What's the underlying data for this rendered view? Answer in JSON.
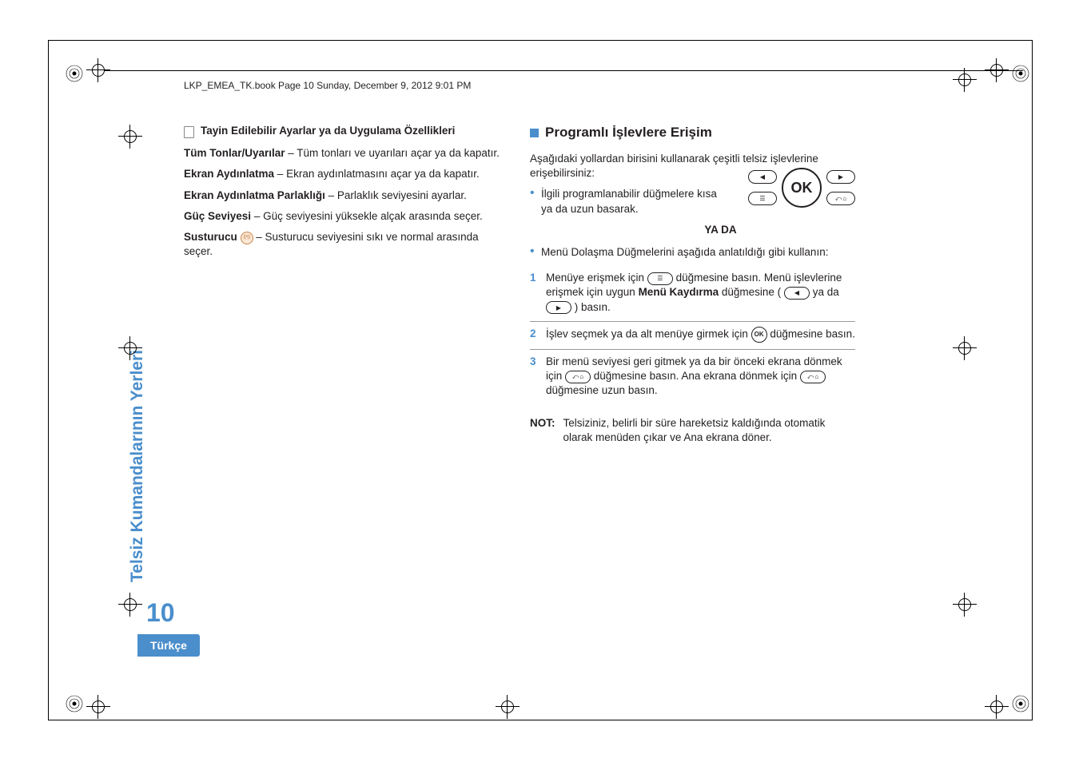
{
  "header": {
    "running_head": "LKP_EMEA_TK.book  Page 10  Sunday, December 9, 2012  9:01 PM"
  },
  "sidebar": {
    "section_title": "Telsiz Kumandalarının Yerleri",
    "page_number": "10",
    "language": "Türkçe"
  },
  "left": {
    "subheading": "Tayin Edilebilir Ayarlar ya da Uygulama Özellikleri",
    "defs": [
      {
        "term": "Tüm Tonlar/Uyarılar",
        "sep": " – ",
        "text": "Tüm tonları ve uyarıları açar ya da kapatır."
      },
      {
        "term": "Ekran Aydınlatma",
        "sep": " – ",
        "text": "Ekran aydınlatmasını açar ya da kapatır."
      },
      {
        "term": "Ekran Aydınlatma Parlaklığı",
        "sep": " – ",
        "text": "Parlaklık seviyesini ayarlar."
      },
      {
        "term": "Güç Seviyesi",
        "sep": " – ",
        "text": "Güç seviyesini yüksekle alçak arasında seçer."
      },
      {
        "term": "Susturucu",
        "sep": "  – ",
        "text": "Susturucu seviyesini sıkı ve normal arasında seçer."
      }
    ]
  },
  "right": {
    "heading": "Programlı İşlevlere Erişim",
    "intro": "Aşağıdaki yollardan birisini kullanarak çeşitli telsiz işlevlerine erişebilirsiniz:",
    "bullet1": "İlgili programlanabilir düğmelere kısa ya da uzun basarak.",
    "or_label": "YA DA",
    "bullet2": "Menü Dolaşma Düğmelerini aşağıda anlatıldığı gibi kullanın:",
    "keypad": {
      "ok": "OK"
    },
    "steps": [
      {
        "num": "1",
        "pre": "Menüye erişmek için ",
        "post1": " düğmesine basın. Menü işlevlerine erişmek için uygun ",
        "bold": "Menü Kaydırma",
        "post2": " düğmesine (",
        "mid": " ya da ",
        "post3": ") basın."
      },
      {
        "num": "2",
        "pre": "İşlev seçmek ya da alt menüye girmek için ",
        "post": " düğmesine basın."
      },
      {
        "num": "3",
        "pre": "Bir menü seviyesi geri gitmek ya da bir önceki ekrana dönmek için ",
        "mid": " düğmesine basın. Ana ekrana dönmek için ",
        "post": " düğmesine uzun basın."
      }
    ],
    "note_label": "NOT:",
    "note_text": "Telsiziniz, belirli bir süre hareketsiz kaldığında otomatik olarak menüden çıkar ve Ana ekrana döner."
  }
}
